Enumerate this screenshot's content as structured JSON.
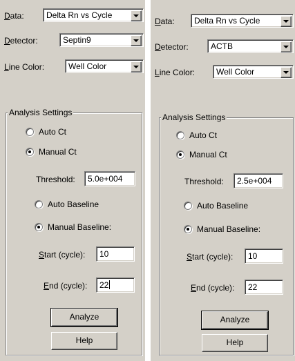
{
  "left": {
    "data_label": "Data:",
    "data_value": "Delta Rn vs Cycle",
    "detector_label": "Detector:",
    "detector_value": "Septin9",
    "line_color_label": "Line Color:",
    "line_color_value": "Well Color",
    "analysis": {
      "title": "Analysis Settings",
      "auto_ct": "Auto Ct",
      "manual_ct": "Manual Ct",
      "ct_mode": "manual",
      "threshold_label": "Threshold:",
      "threshold_value": "5.0e+004",
      "auto_baseline": "Auto Baseline",
      "manual_baseline": "Manual Baseline:",
      "baseline_mode": "manual",
      "start_label": "Start (cycle):",
      "start_value": "10",
      "end_label": "End (cycle):",
      "end_value": "22",
      "analyze_button": "Analyze",
      "help_button": "Help"
    }
  },
  "right": {
    "data_label": "Data:",
    "data_value": "Delta Rn vs Cycle",
    "detector_label": "Detector:",
    "detector_value": "ACTB",
    "line_color_label": "Line Color:",
    "line_color_value": "Well Color",
    "analysis": {
      "title": "Analysis Settings",
      "auto_ct": "Auto Ct",
      "manual_ct": "Manual Ct",
      "ct_mode": "manual",
      "threshold_label": "Threshold:",
      "threshold_value": "2.5e+004",
      "auto_baseline": "Auto Baseline",
      "manual_baseline": "Manual Baseline:",
      "baseline_mode": "manual",
      "start_label": "Start (cycle):",
      "start_value": "10",
      "end_label": "End (cycle):",
      "end_value": "22",
      "analyze_button": "Analyze",
      "help_button": "Help"
    }
  },
  "colors": {
    "face": "#d4d0c8",
    "field": "#ffffff",
    "shadow": "#808080",
    "text": "#000000"
  }
}
